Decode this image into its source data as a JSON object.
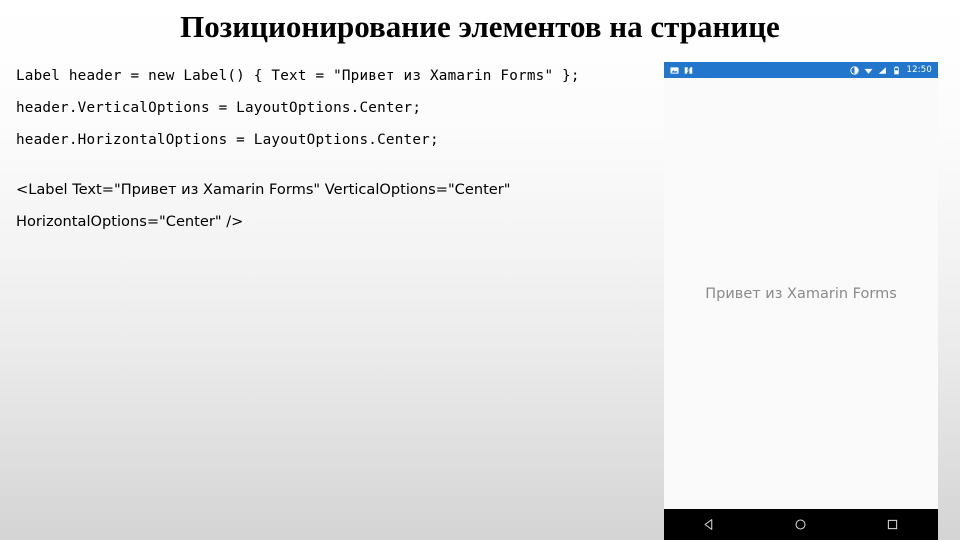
{
  "slide": {
    "title": "Позиционирование элементов на странице",
    "background_top_color": "#ffffff",
    "background_bottom_color": "#d4d4d4"
  },
  "code_block": {
    "language": "csharp",
    "lines": [
      "Label header = new Label() { Text = \"Привет из Xamarin Forms\" };",
      "header.VerticalOptions = LayoutOptions.Center;",
      "header.HorizontalOptions = LayoutOptions.Center;"
    ]
  },
  "xaml_block": {
    "language": "xaml",
    "lines": [
      "<Label Text=\"Привет из Xamarin Forms\" VerticalOptions=\"Center\"",
      "HorizontalOptions=\"Center\" />"
    ]
  },
  "phone": {
    "status_bar": {
      "background_color": "#2277cc",
      "clock": "12:50",
      "left_icons": [
        "screenshot-icon",
        "activity-icon"
      ],
      "right_icons": [
        "rotation-lock-icon",
        "wifi-icon",
        "signal-icon",
        "battery-icon"
      ]
    },
    "screen": {
      "background_color": "#fafafa",
      "label_text": "Привет из Xamarin Forms",
      "label_color": "#8a8a8a",
      "label_vertical_options": "Center",
      "label_horizontal_options": "Center"
    },
    "nav_bar": {
      "background_color": "#000000",
      "buttons": [
        "back-button",
        "home-button",
        "recents-button"
      ]
    }
  }
}
